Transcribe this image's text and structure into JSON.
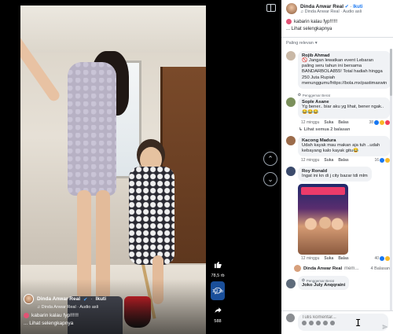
{
  "video": {
    "caption": {
      "author": "Dinda Anwar Real",
      "separator": "·",
      "follow_label": "Ikuti",
      "audio": "♫ Dinda Anwar Real · Audio asli",
      "text": "kabarin kalau fyp!!!!!!",
      "more": "... Lihat selengkapnya"
    },
    "actions": {
      "like_count": "78,5 rb",
      "comment_count": "1,2 rb",
      "share_count": "588"
    }
  },
  "panel": {
    "author": "Dinda Anwar Real",
    "follow_label": "Ikuti",
    "audio": "♫ Dinda Anwar Real · Audio asli",
    "caption": "kabarin kalau fyp!!!!!!",
    "more": "... Lihat selengkapnya",
    "sort_label": "Paling relevan",
    "comments": [
      {
        "name": "Rojib Ahmad",
        "text": "🚫 Jangan lewatkan event Lebaran paling seru tahun ini bersama BANDARBOLA855! Total hadiah hingga 250 Juta Rupiah menunggumu!https://bola.mx/pastimaxwin",
        "avatar_color": "#c9b8a6"
      },
      {
        "badge": "Penggemar Berat",
        "name": "Sople Asane",
        "text": "Yg bener.. biar aku yg lihat, bener ngak.. 😂😂😂",
        "time": "12 minggu",
        "like": "Suka",
        "reply": "Balas",
        "reactions": "38",
        "avatar_color": "#7a8f5a"
      },
      {
        "name": "Kacong Madura",
        "text": "Udah kayak mau makan aja tuh ..udah kebayang kalo kayak gitu😂",
        "time": "12 minggu",
        "like": "Suka",
        "reply": "Balas",
        "reactions": "16",
        "avatar_color": "#9b6b4a"
      },
      {
        "name": "Roy Ronald",
        "text": "Ingat ini kn di j city bazar tdi mlm",
        "time": "12 minggu",
        "like": "Suka",
        "reply": "Balas",
        "reactions": "40",
        "replies": "4 Balasan",
        "avatar_color": "#3b4a6b"
      },
      {
        "name": "Dinda Anwar Real",
        "text": "mem...",
        "avatar_color": "#d7a07c"
      },
      {
        "badge": "Penggemar Berat",
        "name": "Joko July Anqqraini",
        "text": "",
        "avatar_color": "#5e6b7a"
      }
    ],
    "view_replies_label": "Lihat semua 2 balasan",
    "composer": {
      "placeholder": "Tulis komentar..."
    }
  }
}
